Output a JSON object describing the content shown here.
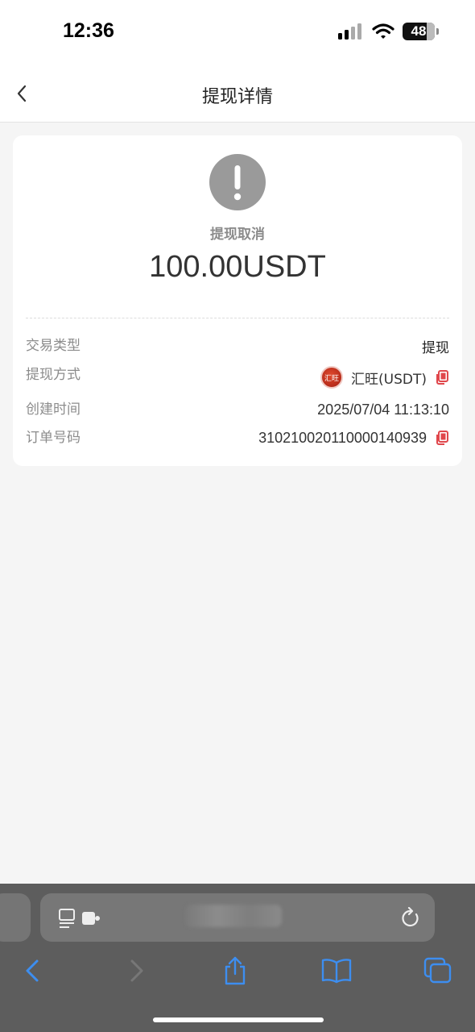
{
  "status_bar": {
    "time": "12:36",
    "battery": "48"
  },
  "header": {
    "title": "提现详情"
  },
  "card": {
    "status_label": "提现取消",
    "amount": "100.00USDT",
    "rows": [
      {
        "label": "交易类型",
        "value": "提现"
      },
      {
        "label": "提现方式",
        "value": "汇旺(USDT)",
        "logo_text": "汇旺"
      },
      {
        "label": "创建时间",
        "value": "2025/07/04 11:13:10"
      },
      {
        "label": "订单号码",
        "value": "310210020110000140939"
      }
    ]
  },
  "colors": {
    "accent": "#e0474c",
    "status_grey": "#9a9a9a",
    "browser_blue": "#3d8ef0"
  },
  "icons": [
    "chevron-left-icon",
    "exclamation-icon",
    "copy-icon",
    "reader-icon",
    "extension-icon",
    "reload-icon",
    "share-icon",
    "bookmarks-icon",
    "tabs-icon"
  ]
}
